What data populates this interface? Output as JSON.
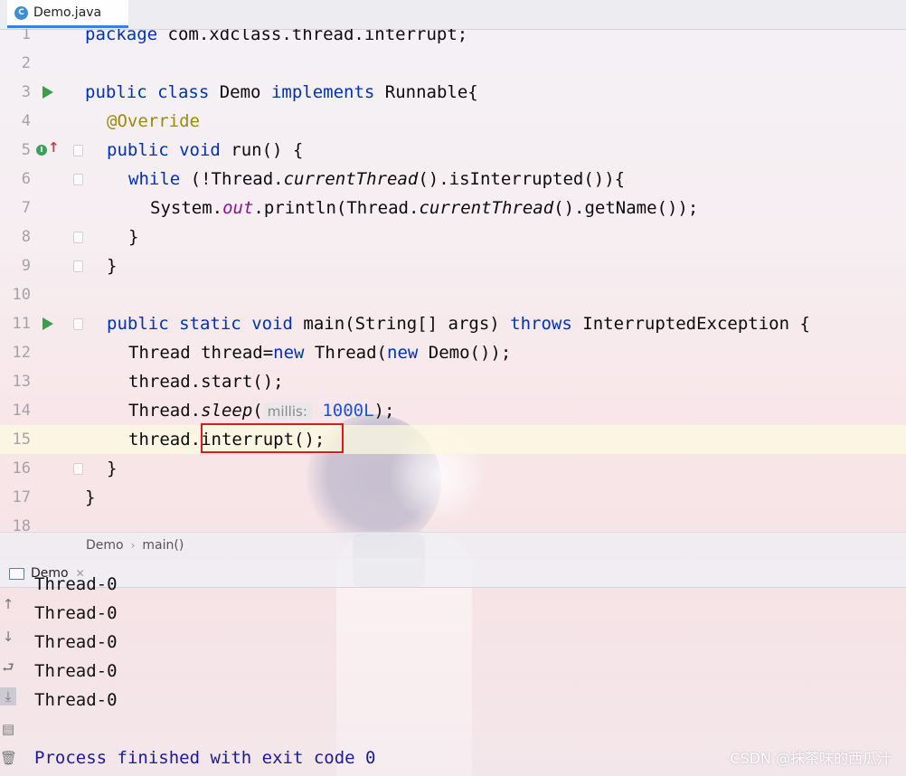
{
  "editor_tab": {
    "icon_letter": "C",
    "label": "Demo.java"
  },
  "lines": [
    {
      "n": "1"
    },
    {
      "n": "2"
    },
    {
      "n": "3"
    },
    {
      "n": "4"
    },
    {
      "n": "5"
    },
    {
      "n": "6"
    },
    {
      "n": "7"
    },
    {
      "n": "8"
    },
    {
      "n": "9"
    },
    {
      "n": "10"
    },
    {
      "n": "11"
    },
    {
      "n": "12"
    },
    {
      "n": "13"
    },
    {
      "n": "14"
    },
    {
      "n": "15"
    },
    {
      "n": "16"
    },
    {
      "n": "17"
    },
    {
      "n": "18"
    }
  ],
  "code": {
    "l1": {
      "kw": "package",
      "rest": " com.xdclass.thread.interrupt;"
    },
    "l3": {
      "kw1": "public",
      "kw2": "class",
      "name": " Demo ",
      "kw3": "implements",
      "rest": " Runnable{"
    },
    "l4": {
      "ann": "@Override"
    },
    "l5": {
      "kw1": "public",
      "kw2": "void",
      "rest": " run() {"
    },
    "l6": {
      "kw": "while",
      "a": " (!Thread.",
      "st": "currentThread",
      "b": "().isInterrupted()){"
    },
    "l7": {
      "a": "System.",
      "fld": "out",
      "b": ".println(Thread.",
      "st": "currentThread",
      "c": "().getName());"
    },
    "l8": {
      "a": "}"
    },
    "l9": {
      "a": "}"
    },
    "l11": {
      "kw1": "public",
      "kw2": "static",
      "kw3": "void",
      "a": " main(String[] args) ",
      "kw4": "throws",
      "b": " InterruptedException {"
    },
    "l12": {
      "a": "Thread thread=",
      "kw": "new",
      "b": " Thread(",
      "kw2": "new",
      "c": " Demo());"
    },
    "l13": {
      "a": "thread.start();"
    },
    "l14": {
      "a": "Thread.",
      "st": "sleep",
      "b": "(",
      "hint": "millis:",
      "num": "1000L",
      "c": ");"
    },
    "l15": {
      "a": "thread.",
      "b": "interrupt();"
    },
    "l16": {
      "a": "}"
    },
    "l17": {
      "a": "}"
    }
  },
  "gutter_icons": {
    "implements_letter": "I",
    "override_arrow": "↑"
  },
  "breadcrumb": {
    "class": "Demo",
    "method": "main()",
    "separator": "›"
  },
  "run_window": {
    "tab_label": "Demo",
    "close": "✕"
  },
  "run_toolbar": {
    "up": "↑",
    "down": "↓",
    "wrap": "⮐",
    "scroll": "⤓",
    "print": "▤",
    "trash": "🗑"
  },
  "console_output": [
    "Thread-0",
    "Thread-0",
    "Thread-0",
    "Thread-0",
    "Thread-0",
    "",
    "Process finished with exit code 0"
  ],
  "watermark": "CSDN @抹茶味的西瓜汁",
  "colors": {
    "keyword": "#0033b3",
    "annotation": "#9e880d",
    "field": "#871094",
    "number": "#1750eb",
    "highlight_box": "#e01818",
    "run_icon": "#3a9e4a"
  }
}
